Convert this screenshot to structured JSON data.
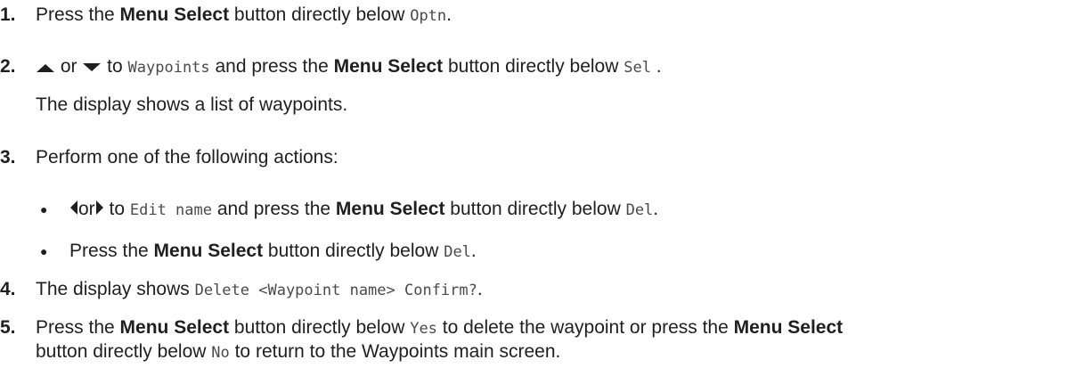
{
  "steps": [
    {
      "number": "1.",
      "pre": "Press the ",
      "bold": "Menu Select",
      "mid": " button directly below ",
      "mono": "Optn",
      "post": "."
    },
    {
      "number": "2.",
      "or": " or ",
      "to": " to ",
      "mono": "Waypoints",
      "mid": " and press the ",
      "bold": "Menu Select",
      "mid2": " button directly below ",
      "mono2": "Sel",
      "post": " .",
      "note": "The display shows a list of waypoints."
    },
    {
      "number": "3.",
      "text": "Perform one of the following actions:",
      "bullets": [
        {
          "glyph": "●",
          "or": "or",
          "to": " to ",
          "mono": "Edit name",
          "mid": " and press the ",
          "bold": "Menu Select",
          "mid2": " button directly below ",
          "mono2": "Del",
          "post": "."
        },
        {
          "glyph": "●",
          "pre": "Press the ",
          "bold": "Menu Select",
          "mid": " button directly below ",
          "mono": "Del",
          "post": "."
        }
      ]
    },
    {
      "number": "4.",
      "pre": "The display shows ",
      "mono": "Delete <Waypoint name> Confirm?",
      "post": "."
    },
    {
      "number": "5.",
      "pre": "Press the ",
      "bold": "Menu Select",
      "mid": " button directly below ",
      "mono": "Yes",
      "mid2": " to delete the waypoint or press the ",
      "bold2": "Menu Select",
      "line2_pre": "button directly below ",
      "line2_mono": "No",
      "line2_post": " to return to the Waypoints main screen."
    }
  ],
  "icons": {
    "up": "up-arrow-icon",
    "down": "down-arrow-icon",
    "left": "left-arrow-icon",
    "right": "right-arrow-icon"
  },
  "colors": {
    "text": "#1f1f1f",
    "mono": "#4a4a4a"
  }
}
